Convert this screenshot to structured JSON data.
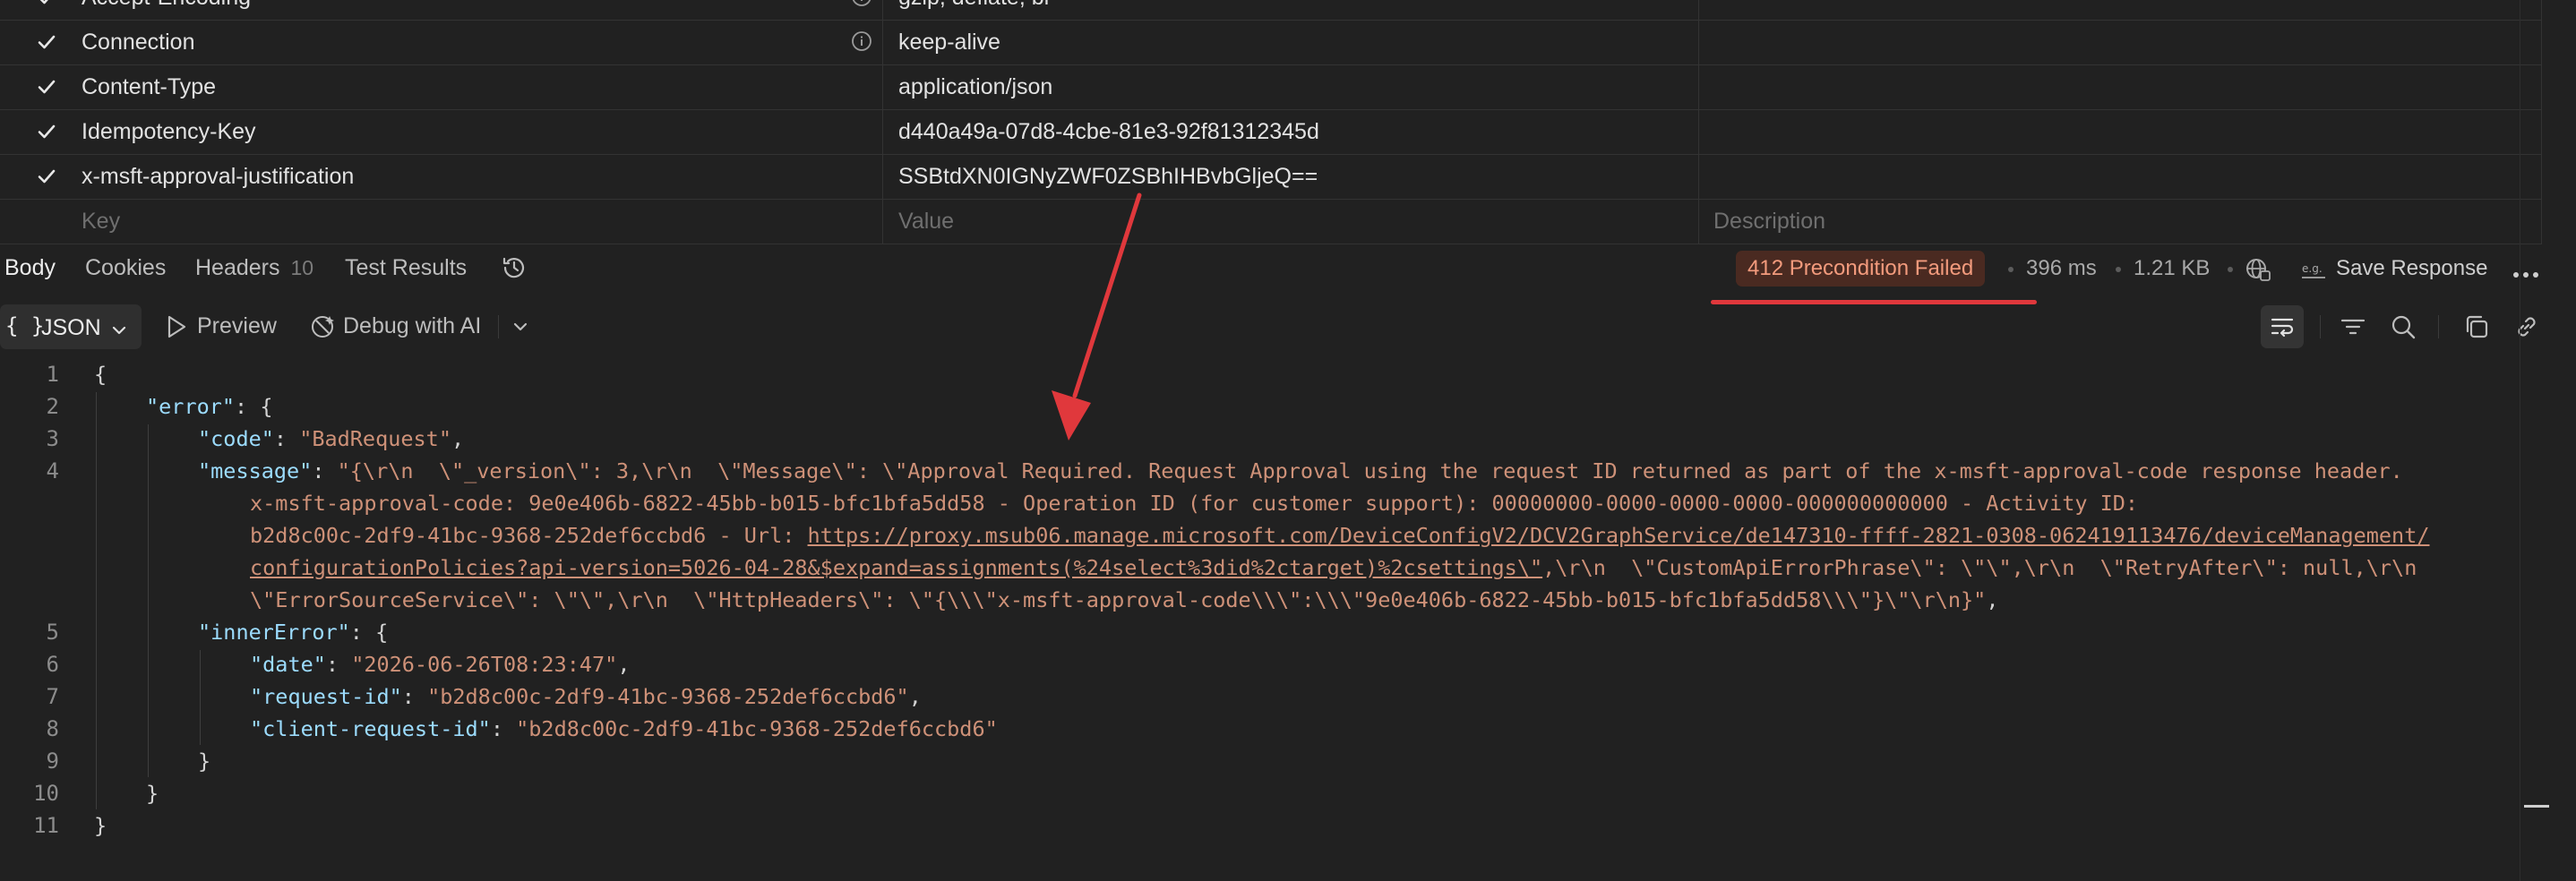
{
  "headers_table": {
    "rows": [
      {
        "key": "Accept-Encoding",
        "value": "gzip, deflate, br",
        "info": true
      },
      {
        "key": "Connection",
        "value": "keep-alive",
        "info": true
      },
      {
        "key": "Content-Type",
        "value": "application/json",
        "info": false
      },
      {
        "key": "Idempotency-Key",
        "value": "d440a49a-07d8-4cbe-81e3-92f81312345d",
        "info": false
      },
      {
        "key": "x-msft-approval-justification",
        "value": "SSBtdXN0IGNyZWF0ZSBhIHBvbGljeQ==",
        "info": false
      }
    ],
    "placeholder": {
      "key": "Key",
      "value": "Value",
      "description": "Description"
    }
  },
  "response_tabs": {
    "body": "Body",
    "cookies": "Cookies",
    "headers": "Headers",
    "headers_count": "10",
    "test_results": "Test Results"
  },
  "response_meta": {
    "status": "412 Precondition Failed",
    "time": "396 ms",
    "size": "1.21 KB",
    "save_response": "Save Response",
    "status_color": "#f39b7d",
    "annotation_color": "#e0383c"
  },
  "toolbar": {
    "format_icon": "{ }",
    "format": "JSON",
    "preview": "Preview",
    "debug": "Debug with AI"
  },
  "code": {
    "line_numbers": [
      "1",
      "2",
      "3",
      "4",
      "5",
      "6",
      "7",
      "8",
      "9",
      "10",
      "11"
    ],
    "l1": "{",
    "l2_key": "\"error\"",
    "l2_rest": ": {",
    "l3_key": "\"code\"",
    "l3_sep": ": ",
    "l3_val": "\"BadRequest\"",
    "l3_end": ",",
    "l4_key": "\"message\"",
    "l4_sep": ": ",
    "l4_line1": "\"{\\r\\n  \\\"_version\\\": 3,\\r\\n  \\\"Message\\\": \\\"Approval Required. Request Approval using the request ID returned as part of the x-msft-approval-code response header.",
    "l4_line2": "x-msft-approval-code: 9e0e406b-6822-45bb-b015-bfc1bfa5dd58 - Operation ID (for customer support): 00000000-0000-0000-0000-000000000000 - Activity ID:",
    "l4_line3_pre": "b2d8c00c-2df9-41bc-9368-252def6ccbd6 - Url: ",
    "l4_line3_url": "https://proxy.msub06.manage.microsoft.com/DeviceConfigV2/DCV2GraphService/de147310-ffff-2821-0308-062419113476/deviceManagement/",
    "l4_line4_url": "configurationPolicies?api-version=5026-04-28&$expand=assignments(%24select%3did%2ctarget)%2csettings\\\"",
    "l4_line4_rest": ",\\r\\n  \\\"CustomApiErrorPhrase\\\": \\\"\\\",\\r\\n  \\\"RetryAfter\\\": null,\\r\\n",
    "l4_line5": "\\\"ErrorSourceService\\\": \\\"\\\",\\r\\n  \\\"HttpHeaders\\\": \\\"{\\\\\\\"x-msft-approval-code\\\\\\\":\\\\\\\"9e0e406b-6822-45bb-b015-bfc1bfa5dd58\\\\\\\"}\\\"\\r\\n}\"",
    "l4_end": ",",
    "l5_key": "\"innerError\"",
    "l5_rest": ": {",
    "l6_key": "\"date\"",
    "l6_sep": ": ",
    "l6_val": "\"2026-06-26T08:23:47\"",
    "l6_end": ",",
    "l7_key": "\"request-id\"",
    "l7_sep": ": ",
    "l7_val": "\"b2d8c00c-2df9-41bc-9368-252def6ccbd6\"",
    "l7_end": ",",
    "l8_key": "\"client-request-id\"",
    "l8_sep": ": ",
    "l8_val": "\"b2d8c00c-2df9-41bc-9368-252def6ccbd6\"",
    "l9": "}",
    "l10": "}",
    "l11": "}"
  }
}
